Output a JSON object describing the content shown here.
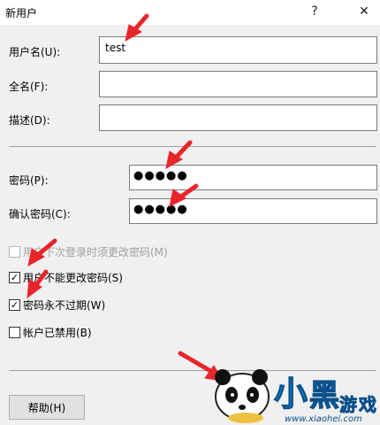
{
  "window": {
    "title": "新用户",
    "help_button": "?",
    "close_button": "✕"
  },
  "form": {
    "username": {
      "label": "用户名(U):",
      "value": "test"
    },
    "fullname": {
      "label": "全名(F):",
      "value": ""
    },
    "description": {
      "label": "描述(D):",
      "value": ""
    },
    "password": {
      "label": "密码(P):",
      "value": "●●●●●"
    },
    "confirm_password": {
      "label": "确认密码(C):",
      "value": "●●●●●"
    }
  },
  "options": [
    {
      "label": "用户下次登录时须更改密码(M)",
      "checked": false,
      "disabled": true
    },
    {
      "label": "用户不能更改密码(S)",
      "checked": true,
      "disabled": false
    },
    {
      "label": "密码永不过期(W)",
      "checked": true,
      "disabled": false
    },
    {
      "label": "帐户已禁用(B)",
      "checked": false,
      "disabled": false
    }
  ],
  "buttons": {
    "help": "帮助(H)"
  },
  "watermark": {
    "text": "小黑游戏",
    "url": "www.xiaohei.com"
  },
  "colors": {
    "arrow": "#e8262a",
    "accent": "#1aa0e8"
  }
}
